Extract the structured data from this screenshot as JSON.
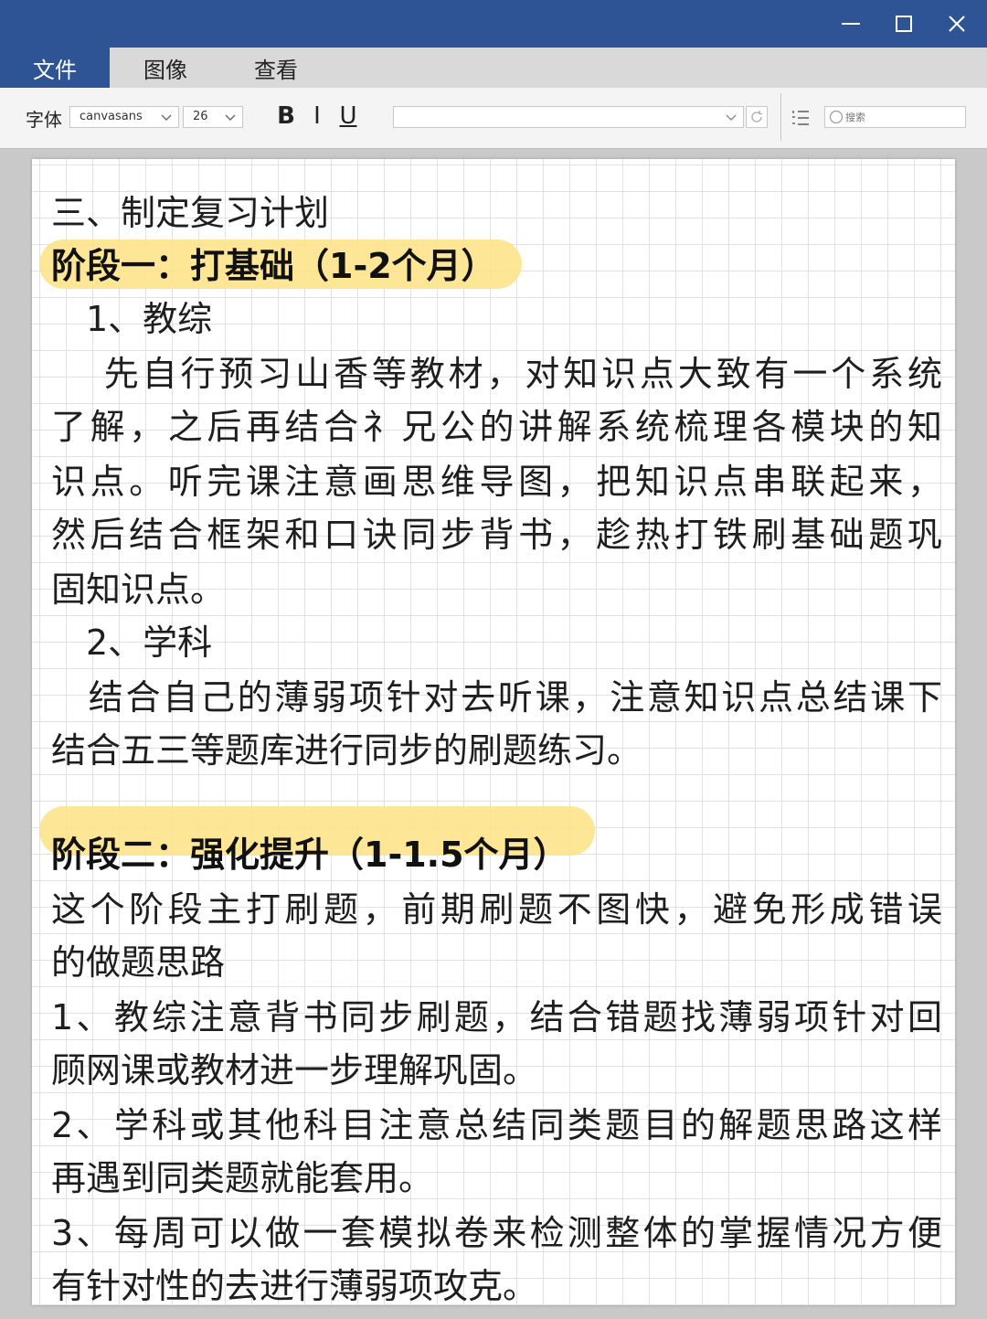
{
  "menu": {
    "items": [
      {
        "label": "文件",
        "active": true
      },
      {
        "label": "图像",
        "active": false
      },
      {
        "label": "查看",
        "active": false
      }
    ]
  },
  "toolbar": {
    "font_label": "字体",
    "font_name": "canvasans",
    "font_size": "26",
    "bold": "B",
    "italic": "I",
    "underline": "U",
    "search_placeholder": "搜索"
  },
  "colors": {
    "titlebar": "#2f5496",
    "highlight": "#fde38a"
  },
  "doc": {
    "lines": [
      "三、制定复习计划",
      "阶段一：打基础（1-2个月）",
      "　1、教综",
      "　 先自行预习山香等教材，对知识点大致有一个系统",
      "了解，之后再结合礻兄公的讲解系统梳理各模块的知",
      "识点。听完课注意画思维导图，把知识点串联起来，",
      "然后结合框架和口诀同步背书，趁热打铁刷基础题巩",
      "固知识点。",
      "　2、学科",
      "　结合自己的薄弱项针对去听课，注意知识点总结课下",
      "结合五三等题库进行同步的刷题练习。",
      "阶段二：强化提升（1-1.5个月）",
      "这个阶段主打刷题，前期刷题不图快，避免形成错误",
      "的做题思路",
      " 1、教综注意背书同步刷题，结合错题找薄弱项针对回",
      "顾网课或教材进一步理解巩固。",
      " 2、学科或其他科目注意总结同类题目的解题思路这样",
      "再遇到同类题就能套用。",
      "3、每周可以做一套模拟卷来检测整体的掌握情况方便",
      "有针对性的去进行薄弱项攻克。"
    ]
  }
}
